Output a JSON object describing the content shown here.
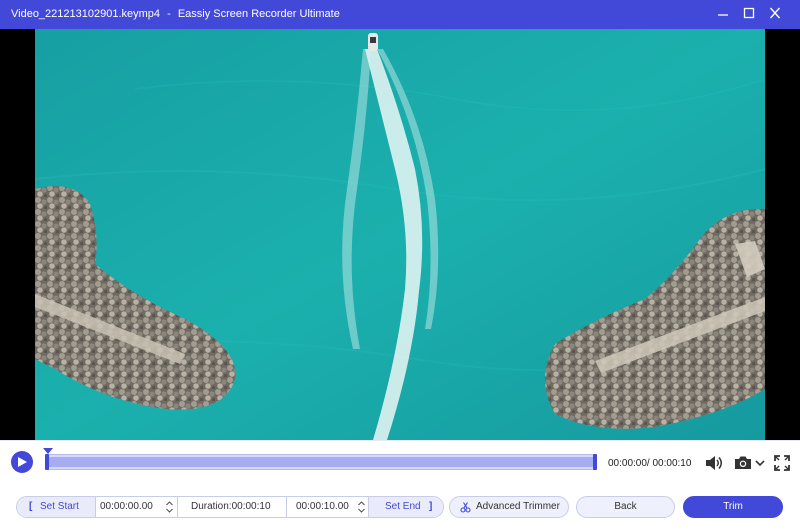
{
  "window": {
    "file_name": "Video_221213102901.keymp4",
    "separator": "-",
    "app_name": "Eassiy Screen Recorder Ultimate"
  },
  "player": {
    "time_readout": "00:00:00/ 00:00:10",
    "progress_fraction": 0.0
  },
  "trimmer": {
    "set_start_bracket": "[",
    "set_start_label": "Set Start",
    "start_time": "00:00:00.00",
    "duration": "Duration:00:00:10",
    "end_time": "00:00:10.00",
    "set_end_label": "Set End",
    "set_end_bracket": "]",
    "advanced_trimmer_label": "Advanced Trimmer"
  },
  "actions": {
    "back_label": "Back",
    "trim_label": "Trim"
  },
  "colors": {
    "accent": "#4248d8",
    "water": "#1aa5a6",
    "timeline_bg": "#d6d9f7"
  },
  "icons": [
    "minimize-icon",
    "maximize-icon",
    "close-icon",
    "play-icon",
    "volume-icon",
    "camera-icon",
    "chevron-down-icon",
    "fullscreen-icon",
    "scissors-icon"
  ]
}
